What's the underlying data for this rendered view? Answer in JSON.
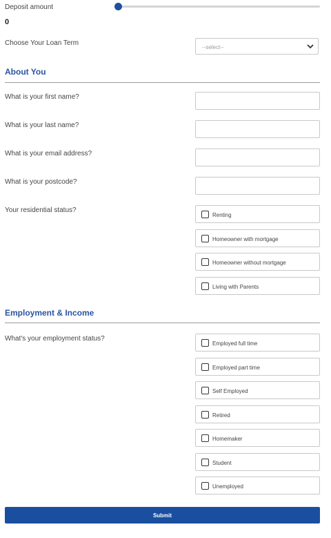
{
  "deposit": {
    "label": "Deposit amount",
    "value": "0",
    "slider_fraction": 0
  },
  "loan_term": {
    "label": "Choose Your Loan Term",
    "placeholder": "--select--"
  },
  "about": {
    "title": "About You",
    "first_name_label": "What is your first name?",
    "last_name_label": "What is your last name?",
    "email_label": "What is your email address?",
    "postcode_label": "What is your postcode?",
    "residential_label": "Your residential status?",
    "residential_options": [
      "Renting",
      "Homeowner with mortgage",
      "Homeowner without mortgage",
      "Living with Parents"
    ]
  },
  "employment": {
    "title": "Employment & Income",
    "status_label": "What's your employment status?",
    "options": [
      "Employed full time",
      "Employed part time",
      "Self Employed",
      "Retired",
      "Homemaker",
      "Student",
      "Unemployed"
    ]
  },
  "submit_label": "Submit",
  "colors": {
    "accent": "#1a4fa0",
    "section_title": "#2a55a0"
  }
}
